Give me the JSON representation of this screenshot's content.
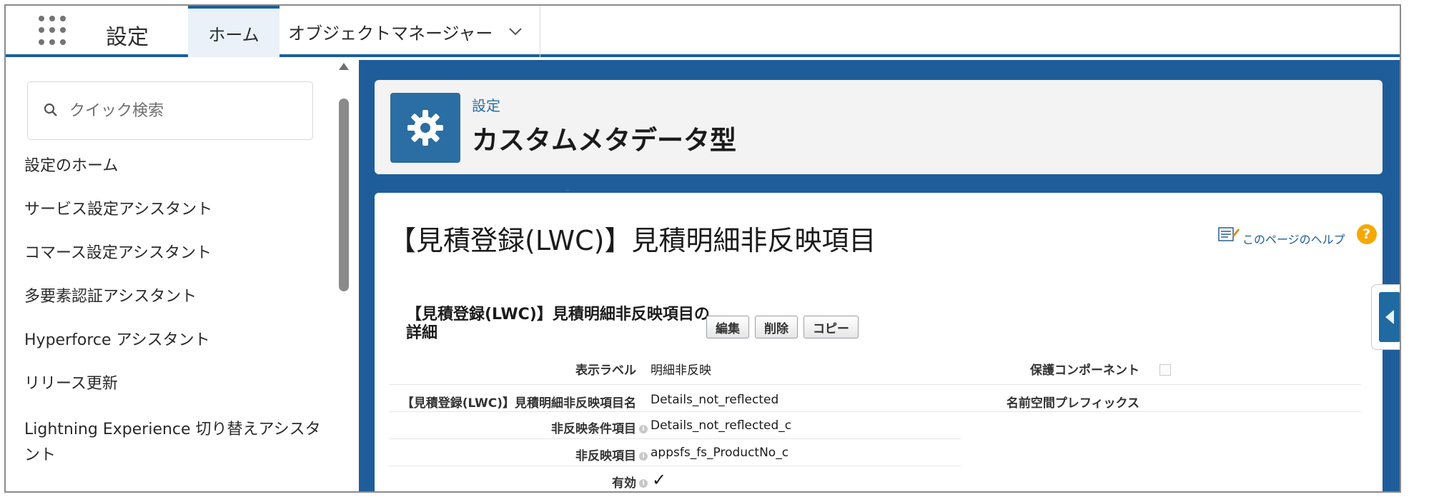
{
  "topbar": {
    "app_name": "設定",
    "tabs": [
      {
        "label": "ホーム",
        "active": true
      },
      {
        "label": "オブジェクトマネージャー",
        "active": false
      }
    ]
  },
  "sidebar": {
    "search_placeholder": "クイック検索",
    "items": [
      {
        "label": "設定のホーム"
      },
      {
        "label": "サービス設定アシスタント"
      },
      {
        "label": "コマース設定アシスタント"
      },
      {
        "label": "多要素認証アシスタント"
      },
      {
        "label": "Hyperforce アシスタント"
      },
      {
        "label": "リリース更新"
      },
      {
        "label": "Lightning Experience 切り替えアシスタント"
      }
    ]
  },
  "header": {
    "eyebrow": "設定",
    "title": "カスタムメタデータ型"
  },
  "detail": {
    "record_title": "【見積登録(LWC)】見積明細非反映項目",
    "help_label": "このページのヘルプ",
    "section_title": "【見積登録(LWC)】見積明細非反映項目の詳細",
    "buttons": {
      "edit": "編集",
      "delete": "削除",
      "copy": "コピー"
    },
    "fields": {
      "display_label": {
        "label": "表示ラベル",
        "value": "明細非反映"
      },
      "record_name": {
        "label": "【見積登録(LWC)】見積明細非反映項目名",
        "value": "Details_not_reflected"
      },
      "condition_field": {
        "label": "非反映条件項目",
        "value": "Details_not_reflected_c"
      },
      "excluded_field": {
        "label": "非反映項目",
        "value": "appsfs_fs_ProductNo_c"
      },
      "active": {
        "label": "有効",
        "value": "✓"
      },
      "protected_component": {
        "label": "保護コンポーネント",
        "checked": false
      },
      "namespace_prefix": {
        "label": "名前空間プレフィックス",
        "value": ""
      }
    }
  },
  "colors": {
    "brand_blue": "#1f5d9a",
    "icon_blue": "#2b6ea3",
    "help_orange": "#f6a800"
  }
}
